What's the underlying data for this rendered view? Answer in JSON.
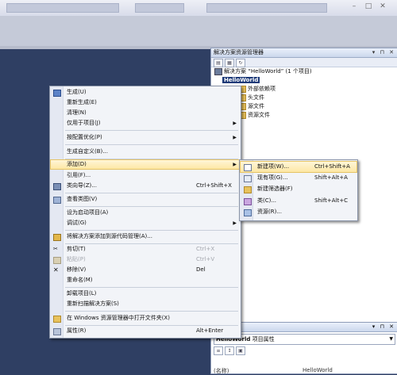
{
  "solution_explorer": {
    "title": "解决方案资源管理器",
    "pin": "▾ ⊓ ✕",
    "solution_line": "解决方案 “HelloWorld” (1 个项目)",
    "project": "HelloWorld",
    "items": [
      "外部依赖项",
      "头文件",
      "源文件",
      "资源文件"
    ]
  },
  "properties": {
    "pin": "▾ ⊓ ✕",
    "selector_name": "HelloWorld",
    "selector_suffix": " 项目属性",
    "row_left": "(名称)",
    "row_right": "HelloWorld"
  },
  "menu": {
    "items": [
      {
        "label": "生成(U)",
        "icon": "build-icon"
      },
      {
        "label": "重新生成(E)"
      },
      {
        "label": "清理(N)"
      },
      {
        "label": "仅用于项目(J)",
        "arrow": true
      },
      {
        "label": "按配置优化(P)",
        "arrow": true
      },
      {
        "label": "生成自定义(B)..."
      },
      {
        "label": "添加(D)",
        "arrow": true,
        "highlight": true
      },
      {
        "label": "引用(F)..."
      },
      {
        "label": "类向导(Z)...",
        "shortcut": "Ctrl+Shift+X",
        "icon": "class-wizard-icon"
      },
      {
        "label": "查看类图(V)",
        "icon": "class-diagram-icon"
      },
      {
        "label": "设为启动项目(A)"
      },
      {
        "label": "调试(G)",
        "arrow": true
      },
      {
        "label": "将解决方案添加到源代码管理(A)...",
        "icon": "source-control-icon"
      },
      {
        "label": "剪切(T)",
        "shortcut": "Ctrl+X",
        "icon": "cut-icon"
      },
      {
        "label": "粘贴(P)",
        "shortcut": "Ctrl+V",
        "icon": "paste-icon",
        "disabled": true
      },
      {
        "label": "移除(V)",
        "shortcut": "Del",
        "icon": "remove-icon"
      },
      {
        "label": "重命名(M)"
      },
      {
        "label": "卸载项目(L)"
      },
      {
        "label": "重新扫描解决方案(S)"
      },
      {
        "label": "在 Windows 资源管理器中打开文件夹(X)",
        "icon": "folder-open-icon"
      },
      {
        "label": "属性(R)",
        "shortcut": "Alt+Enter",
        "icon": "properties-icon"
      }
    ]
  },
  "submenu": {
    "items": [
      {
        "label": "新建项(W)...",
        "shortcut": "Ctrl+Shift+A",
        "highlight": true
      },
      {
        "label": "现有项(G)...",
        "shortcut": "Shift+Alt+A"
      },
      {
        "label": "新建筛选器(F)"
      },
      {
        "label": "类(C)...",
        "shortcut": "Shift+Alt+C"
      },
      {
        "label": "资源(R)..."
      }
    ]
  },
  "colors": {
    "workspace": "#2f3f63",
    "selection": "#1d3a78",
    "highlight": "#fde7a4"
  }
}
